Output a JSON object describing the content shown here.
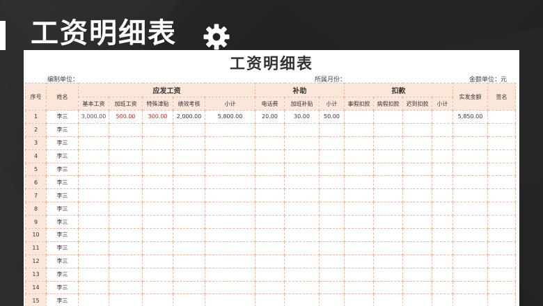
{
  "slide": {
    "title": "工资明细表",
    "icon": "gear-icon"
  },
  "sheet": {
    "title": "工资明细表",
    "unit_label": "编制单位：",
    "month_label": "所属月份：",
    "currency_label": "金额单位：元"
  },
  "headers": {
    "index": "序号",
    "name": "姓名",
    "group_salary": "应发工资",
    "group_allowance": "补助",
    "group_deduction": "扣款",
    "net": "实发金额",
    "sign": "签名",
    "salary_cols": [
      "基本工资",
      "加班工资",
      "特殊津贴",
      "绩效考核",
      "小计"
    ],
    "allowance_cols": [
      "电话费",
      "加班补贴",
      "小计"
    ],
    "deduction_cols": [
      "事假扣款",
      "病假扣款",
      "迟到扣款",
      "小计"
    ]
  },
  "rows": [
    {
      "idx": "1",
      "name": "李三",
      "base": "3,000.00",
      "overtime": "500.00",
      "special": "300.00",
      "perf": "2,000.00",
      "salary_sub": "5,800.00",
      "phone": "20.00",
      "ot_allow": "30.00",
      "allow_sub": "50.00",
      "net": "5,850.00"
    },
    {
      "idx": "2",
      "name": "李三"
    },
    {
      "idx": "3",
      "name": "李三"
    },
    {
      "idx": "4",
      "name": "李三"
    },
    {
      "idx": "5",
      "name": "李三"
    },
    {
      "idx": "6",
      "name": "李三"
    },
    {
      "idx": "7",
      "name": "李三"
    },
    {
      "idx": "8",
      "name": "李三"
    },
    {
      "idx": "9",
      "name": "李三"
    },
    {
      "idx": "10",
      "name": "李三"
    },
    {
      "idx": "11",
      "name": "李三"
    },
    {
      "idx": "12",
      "name": "李三"
    },
    {
      "idx": "13",
      "name": "李三"
    },
    {
      "idx": "14",
      "name": "李三"
    },
    {
      "idx": "15",
      "name": "李三"
    }
  ],
  "colors": {
    "header_fill": "#fbe6da",
    "grid_line": "#e8b8a0",
    "highlight_text": "#e02020"
  }
}
